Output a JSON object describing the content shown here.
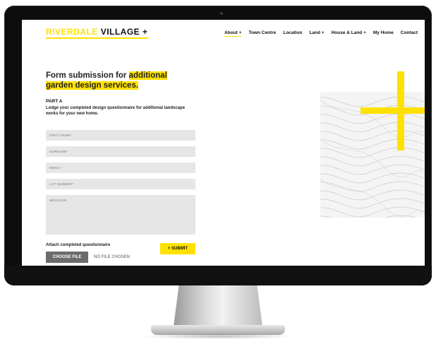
{
  "site": {
    "logo_part1": "RIVERDALE",
    "logo_part2": "VILLAGE +"
  },
  "nav": {
    "items": [
      "About +",
      "Town Centre",
      "Location",
      "Land +",
      "House & Land +",
      "My Home",
      "Contact"
    ],
    "active_index": 0
  },
  "form": {
    "title_plain": "Form submission for ",
    "title_highlight1": "additional",
    "title_highlight2": "garden design services.",
    "section_label": "PART A",
    "lead": "Lodge your completed design questionnaire for additional landscape works for your new home.",
    "fields": {
      "first_name": "FIRST NAME*",
      "surname": "SURNAME*",
      "email": "EMAIL*",
      "lot_number": "LOT NUMBER*",
      "message": "MESSAGE:"
    },
    "attach_label": "Attach completed questionnaire",
    "choose_file": "CHOOSE FILE",
    "no_file": "NO FILE CHOSEN",
    "submit": "+ SUBMIT"
  },
  "colors": {
    "accent": "#ffe100",
    "field_bg": "#e6e6e6",
    "button_grey": "#6b6b6b",
    "bezel": "#0d0d0d"
  }
}
